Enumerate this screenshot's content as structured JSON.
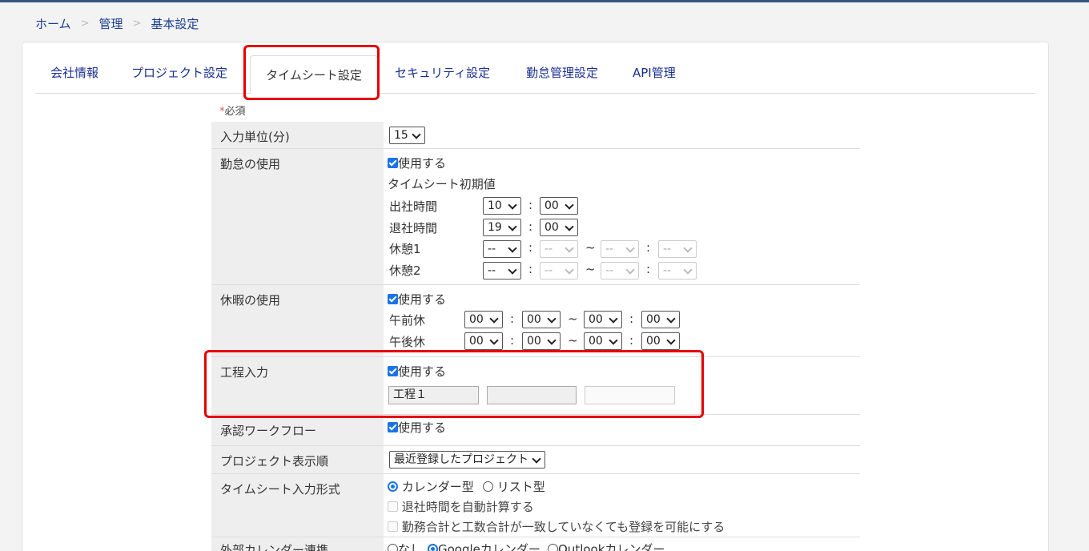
{
  "breadcrumb": [
    "ホーム",
    "管理",
    "基本設定"
  ],
  "breadcrumb_sep": ">",
  "tabs": [
    "会社情報",
    "プロジェクト設定",
    "タイムシート設定",
    "セキュリティ設定",
    "勤怠管理設定",
    "API管理"
  ],
  "active_tab": "タイムシート設定",
  "required_note": {
    "star": "*",
    "text": "必須"
  },
  "use_label": "使用する",
  "rows": {
    "input_unit": {
      "label": "入力単位(分)",
      "value": "15"
    },
    "attendance": {
      "label": "勤怠の使用",
      "initial_title": "タイムシート初期値",
      "start": {
        "label": "出社時間",
        "h": "10",
        "m": "00"
      },
      "end": {
        "label": "退社時間",
        "h": "19",
        "m": "00"
      },
      "break1": {
        "label": "休憩1",
        "a": "--",
        "b": "--",
        "c": "--",
        "d": "--"
      },
      "break2": {
        "label": "休憩2",
        "a": "--",
        "b": "--",
        "c": "--",
        "d": "--"
      }
    },
    "leave": {
      "label": "休暇の使用",
      "am": {
        "label": "午前休",
        "a": "00",
        "b": "00",
        "c": "00",
        "d": "00"
      },
      "pm": {
        "label": "午後休",
        "a": "00",
        "b": "00",
        "c": "00",
        "d": "00"
      }
    },
    "process": {
      "label": "工程入力",
      "inputs": [
        "工程１",
        "",
        ""
      ]
    },
    "approval": {
      "label": "承認ワークフロー"
    },
    "project_order": {
      "label": "プロジェクト表示順",
      "value": "最近登録したプロジェクト"
    },
    "timesheet_format": {
      "label": "タイムシート入力形式",
      "radio_calendar": "カレンダー型",
      "radio_list": "リスト型",
      "auto_calc": "退社時間を自動計算する",
      "allow_mismatch": "勤務合計と工数合計が一致していなくても登録を可能にする"
    },
    "external_calendar": {
      "label": "外部カレンダー連携",
      "none": "なし",
      "google": "Googleカレンダー",
      "outlook": "Outlookカレンダー"
    }
  },
  "colors": {
    "accent": "#1a73e8",
    "highlight": "#e60000",
    "link": "#1a2f8f"
  }
}
